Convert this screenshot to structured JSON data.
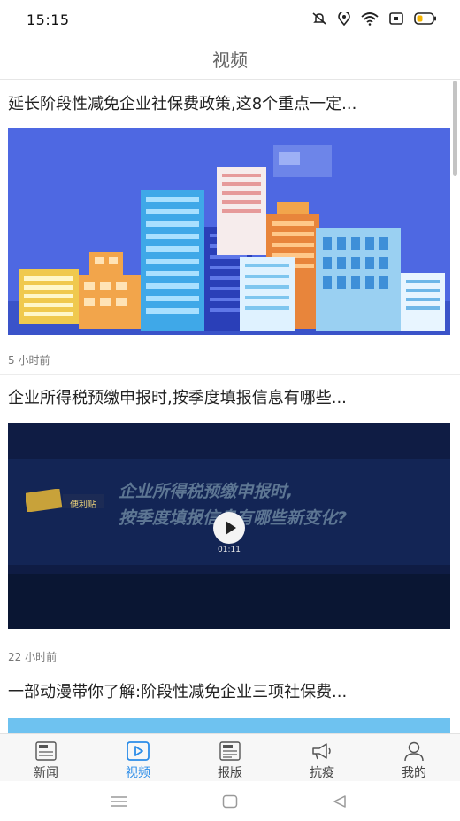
{
  "status_bar": {
    "time": "15:15",
    "icons": [
      "mute-bell-icon",
      "location-icon",
      "wifi-icon",
      "sim-icon",
      "battery-icon"
    ]
  },
  "header": {
    "title": "视频"
  },
  "feed": {
    "articles": [
      {
        "title": "延长阶段性减免企业社保费政策,这8个重点一定...",
        "time": "5 小时前",
        "thumbnail": "city-buildings-illustration"
      },
      {
        "title": "企业所得税预缴申报时,按季度填报信息有哪些...",
        "time": "22 小时前",
        "thumbnail": "video-frame",
        "video": {
          "headline_line1": "企业所得税预缴申报时,",
          "headline_line2": "按季度填报信息有哪些新变化?",
          "duration": "01:11",
          "logo_text": "便利贴"
        }
      },
      {
        "title": "一部动漫带你了解:阶段性减免企业三项社保费...",
        "time": "",
        "thumbnail": "blue-banner"
      }
    ]
  },
  "tab_bar": {
    "tabs": [
      {
        "label": "新闻",
        "icon": "news-icon",
        "active": false
      },
      {
        "label": "视频",
        "icon": "video-play-icon",
        "active": true
      },
      {
        "label": "报版",
        "icon": "newspaper-icon",
        "active": false
      },
      {
        "label": "抗疫",
        "icon": "megaphone-icon",
        "active": false
      },
      {
        "label": "我的",
        "icon": "user-icon",
        "active": false
      }
    ]
  },
  "nav_bar": {
    "buttons": [
      "menu-icon",
      "home-icon",
      "back-icon"
    ]
  },
  "colors": {
    "accent": "#2b8ce8",
    "text": "#222222",
    "muted": "#777777"
  }
}
